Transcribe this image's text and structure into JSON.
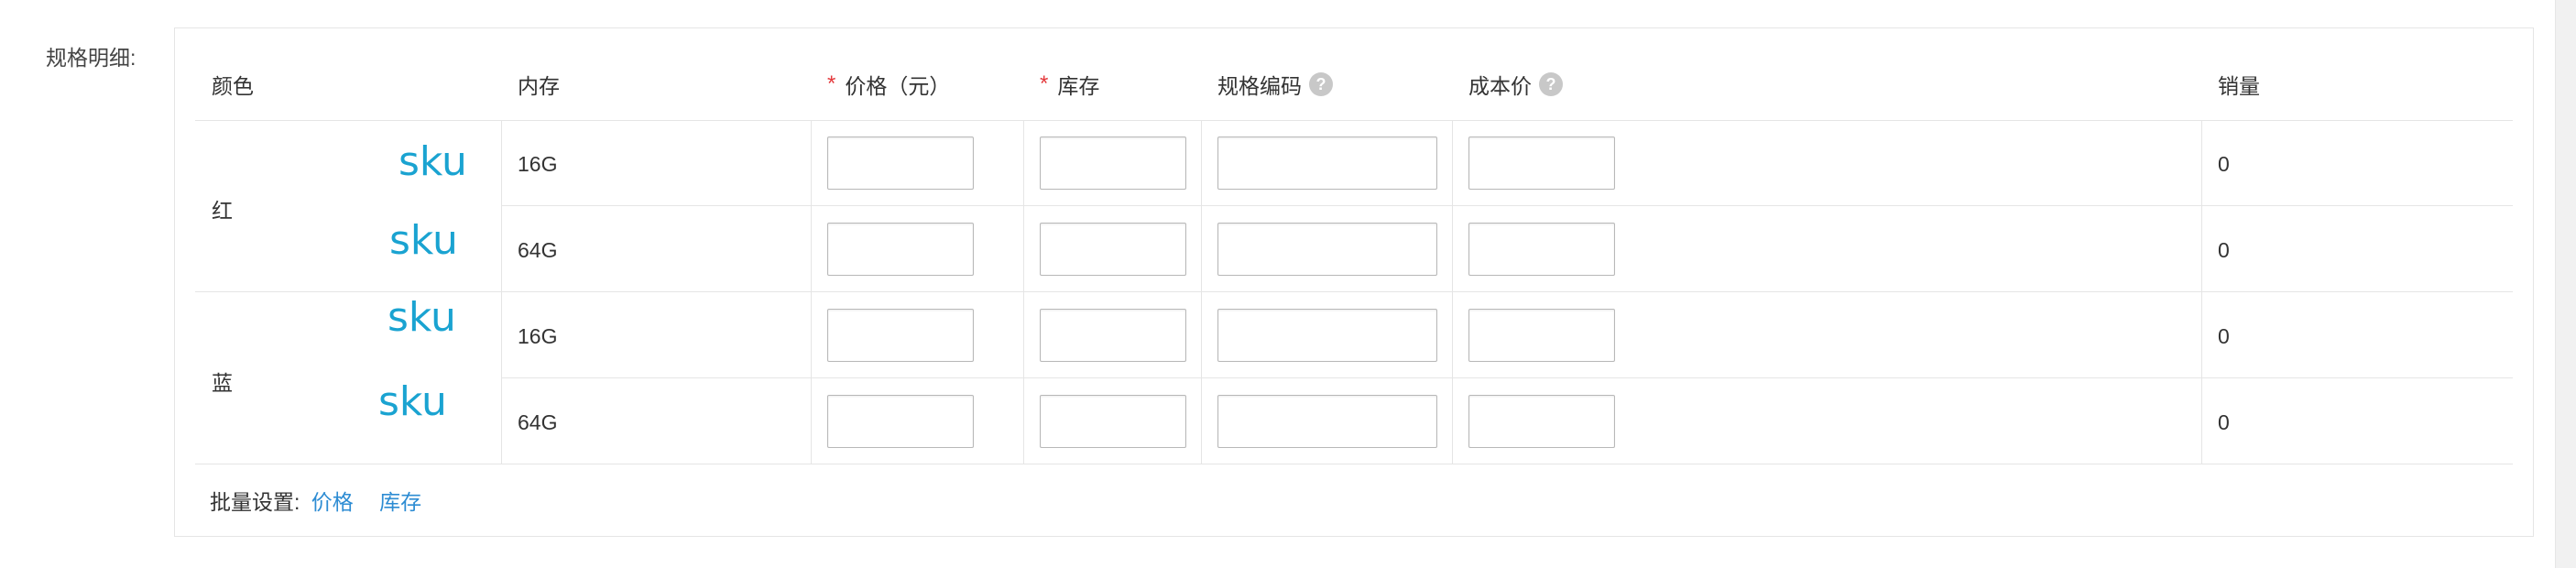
{
  "field_label": "规格明细:",
  "headers": {
    "color": "颜色",
    "memory": "内存",
    "price": "价格（元）",
    "stock": "库存",
    "code": "规格编码",
    "cost": "成本价",
    "sales": "销量",
    "required_mark": "*",
    "help_icon_glyph": "?"
  },
  "colors": [
    {
      "name": "红"
    },
    {
      "name": "蓝"
    }
  ],
  "rows": [
    {
      "sku": "sku",
      "memory": "16G",
      "price": "",
      "stock": "",
      "code": "",
      "cost": "",
      "sales": "0"
    },
    {
      "sku": "sku",
      "memory": "64G",
      "price": "",
      "stock": "",
      "code": "",
      "cost": "",
      "sales": "0"
    },
    {
      "sku": "sku",
      "memory": "16G",
      "price": "",
      "stock": "",
      "code": "",
      "cost": "",
      "sales": "0"
    },
    {
      "sku": "sku",
      "memory": "64G",
      "price": "",
      "stock": "",
      "code": "",
      "cost": "",
      "sales": "0"
    }
  ],
  "footer": {
    "label": "批量设置:",
    "price_link": "价格",
    "stock_link": "库存"
  },
  "colors_theme": {
    "sku": "#1aa3d1",
    "link": "#2d8cd3",
    "required": "#e4393c",
    "border": "#e5e5e5"
  }
}
